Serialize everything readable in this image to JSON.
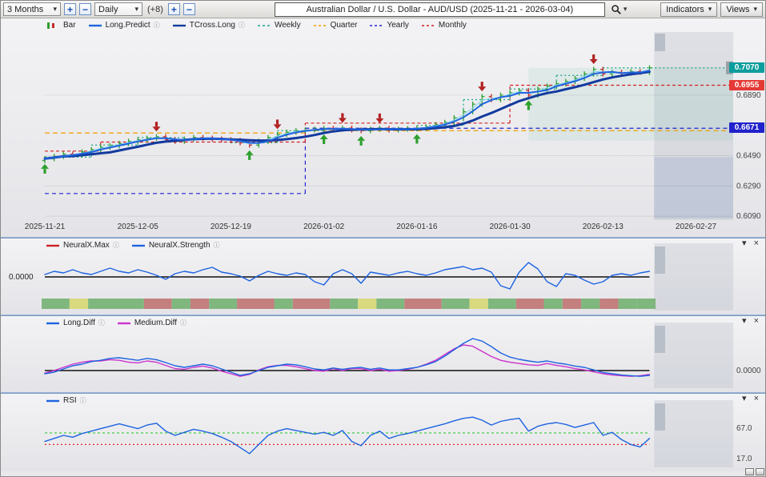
{
  "ui": {
    "caret": "▾",
    "close": "×",
    "collapse": "▾",
    "info": "ⓘ"
  },
  "colors": {
    "up": "#2e9e2e",
    "down": "#c22a2a",
    "long_predict": "#1e63e0",
    "tcross_long": "#123a9e",
    "pale_line": "#7fd4ef",
    "weekly": "#17a689",
    "quarter": "#f0a000",
    "yearly": "#2323cc",
    "monthly": "#d42020",
    "neural_max": "#cc2222",
    "neural_strength": "#1e63e0",
    "long_diff": "#1e63e0",
    "medium_diff": "#cc33cc",
    "rsi": "#1e63e0",
    "strip_green": "#7fb77f",
    "strip_red": "#c47f7f",
    "strip_yellow": "#d9d97f",
    "arrow_up": "#2ea02e",
    "arrow_down": "#b22222"
  },
  "toolbar": {
    "range_value": "3 Months",
    "zoom_in": "+",
    "zoom_out": "−",
    "period_value": "Daily",
    "extra_count": "(+8)",
    "add": "+",
    "remove": "−",
    "title": "Australian Dollar / U.S. Dollar - AUD/USD (2025-11-21 - 2026-03-04)",
    "indicators_label": "Indicators",
    "views_label": "Views"
  },
  "main_chart": {
    "legend": [
      {
        "label": "Bar",
        "style": "bar",
        "color": "#2e9e2e",
        "color2": "#c22a2a"
      },
      {
        "label": "Long.Predict",
        "style": "line",
        "color": "#1e63e0",
        "info": true
      },
      {
        "label": "TCross.Long",
        "style": "line",
        "color": "#123a9e",
        "info": true
      },
      {
        "label": "Weekly",
        "style": "dash",
        "color": "#17a689"
      },
      {
        "label": "Quarter",
        "style": "dash",
        "color": "#f0a000"
      },
      {
        "label": "Yearly",
        "style": "dash",
        "color": "#2323cc"
      },
      {
        "label": "Monthly",
        "style": "dash",
        "color": "#d42020"
      }
    ],
    "x_labels": [
      "2025-11-21",
      "2025-12-05",
      "2025-12-19",
      "2026-01-02",
      "2026-01-16",
      "2026-01-30",
      "2026-02-13",
      "2026-02-27"
    ],
    "x_label_indices": [
      0,
      10,
      20,
      30,
      40,
      50,
      60,
      70
    ],
    "y_tick_labels": [
      "0.6890",
      "0.6490",
      "0.6290",
      "0.6090"
    ],
    "y_tick_values": [
      0.689,
      0.649,
      0.629,
      0.609
    ],
    "badges": [
      {
        "text": "0.7070",
        "value": 0.707,
        "color": "#0d9d9d"
      },
      {
        "text": "0.6955",
        "value": 0.6955,
        "color": "#e53935"
      },
      {
        "text": "0.6671",
        "value": 0.6671,
        "color": "#2222cc"
      }
    ]
  },
  "panels": [
    {
      "id": "neural",
      "legend": [
        {
          "label": "NeuralX.Max",
          "style": "line",
          "color": "#cc2222",
          "info": true
        },
        {
          "label": "NeuralX.Strength",
          "style": "line",
          "color": "#1e63e0",
          "info": true
        }
      ]
    },
    {
      "id": "diff",
      "legend": [
        {
          "label": "Long.Diff",
          "style": "line",
          "color": "#1e63e0",
          "info": true
        },
        {
          "label": "Medium.Diff",
          "style": "line",
          "color": "#cc33cc",
          "info": true
        }
      ]
    },
    {
      "id": "rsi",
      "legend": [
        {
          "label": "RSI",
          "style": "line",
          "color": "#1e63e0",
          "info": true
        }
      ]
    }
  ],
  "chart_data": [
    {
      "id": "price",
      "type": "bar",
      "title": "Australian Dollar / U.S. Dollar - AUD/USD",
      "period": "Daily",
      "date_range": [
        "2025-11-21",
        "2026-03-04"
      ],
      "total_slots": 75,
      "forecast_start": 65,
      "y_range": [
        0.6075,
        0.7275
      ],
      "closes": [
        0.647,
        0.6485,
        0.65,
        0.6495,
        0.6515,
        0.653,
        0.6545,
        0.6555,
        0.657,
        0.6585,
        0.6595,
        0.6605,
        0.6615,
        0.6595,
        0.6585,
        0.66,
        0.661,
        0.6605,
        0.66,
        0.6595,
        0.659,
        0.6575,
        0.656,
        0.6585,
        0.661,
        0.663,
        0.6645,
        0.6655,
        0.666,
        0.6665,
        0.667,
        0.6665,
        0.6672,
        0.666,
        0.6655,
        0.6665,
        0.667,
        0.666,
        0.6665,
        0.6668,
        0.6672,
        0.668,
        0.6695,
        0.671,
        0.674,
        0.678,
        0.683,
        0.688,
        0.686,
        0.689,
        0.6905,
        0.692,
        0.689,
        0.693,
        0.695,
        0.6965,
        0.698,
        0.7,
        0.703,
        0.706,
        0.703,
        0.704,
        0.7035,
        0.7045,
        0.704,
        0.707
      ],
      "signals_up": [
        0,
        22,
        30,
        34,
        40,
        52
      ],
      "signals_down": [
        12,
        25,
        32,
        36,
        47,
        59
      ],
      "levels": {
        "weekly": [
          [
            0,
            5,
            0.648
          ],
          [
            5,
            10,
            0.656
          ],
          [
            10,
            15,
            0.661
          ],
          [
            15,
            20,
            0.66
          ],
          [
            20,
            25,
            0.6575
          ],
          [
            25,
            30,
            0.6655
          ],
          [
            30,
            35,
            0.6668
          ],
          [
            35,
            40,
            0.6663
          ],
          [
            40,
            45,
            0.669
          ],
          [
            45,
            50,
            0.686
          ],
          [
            50,
            55,
            0.693
          ],
          [
            55,
            60,
            0.702
          ],
          [
            60,
            74,
            0.707
          ]
        ],
        "monthly": [
          [
            0,
            6,
            0.652
          ],
          [
            6,
            28,
            0.658
          ],
          [
            28,
            50,
            0.6705
          ],
          [
            50,
            74,
            0.6955
          ]
        ],
        "yearly": [
          [
            0,
            28,
            0.624
          ],
          [
            28,
            74,
            0.6671
          ]
        ],
        "quarter": [
          [
            0,
            28,
            0.664
          ],
          [
            28,
            74,
            0.6655
          ]
        ]
      }
    },
    {
      "id": "neural",
      "type": "line",
      "y_range": [
        -1.2,
        1.2
      ],
      "zero_label": "0.0000",
      "series": [
        {
          "name": "NeuralX.Strength",
          "values": [
            0.15,
            0.35,
            0.25,
            0.45,
            0.25,
            0.15,
            0.35,
            0.55,
            0.35,
            0.25,
            0.45,
            0.3,
            0.1,
            -0.15,
            0.2,
            0.35,
            0.25,
            0.45,
            0.6,
            0.3,
            0.2,
            0.05,
            -0.25,
            0.1,
            0.35,
            0.2,
            0.1,
            0.25,
            0.15,
            -0.3,
            -0.5,
            0.2,
            0.45,
            0.2,
            -0.4,
            0.3,
            0.2,
            0.1,
            0.25,
            0.35,
            0.2,
            0.1,
            0.25,
            0.45,
            0.55,
            0.65,
            0.45,
            0.55,
            0.3,
            -0.55,
            -0.75,
            0.3,
            0.9,
            0.5,
            -0.3,
            -0.6,
            0.2,
            0.1,
            -0.2,
            -0.45,
            -0.3,
            0.1,
            0.2,
            0.1,
            0.25,
            0.35
          ]
        }
      ],
      "strip": [
        [
          "g",
          3
        ],
        [
          "y",
          2
        ],
        [
          "g",
          6
        ],
        [
          "r",
          3
        ],
        [
          "g",
          2
        ],
        [
          "r",
          2
        ],
        [
          "g",
          3
        ],
        [
          "r",
          4
        ],
        [
          "g",
          2
        ],
        [
          "r",
          4
        ],
        [
          "g",
          3
        ],
        [
          "y",
          2
        ],
        [
          "g",
          3
        ],
        [
          "r",
          4
        ],
        [
          "g",
          3
        ],
        [
          "y",
          2
        ],
        [
          "g",
          3
        ],
        [
          "r",
          3
        ],
        [
          "g",
          2
        ],
        [
          "r",
          2
        ],
        [
          "g",
          2
        ],
        [
          "r",
          2
        ],
        [
          "g",
          2
        ],
        [
          "g",
          2
        ]
      ]
    },
    {
      "id": "diff",
      "type": "line",
      "y_range": [
        -0.005,
        0.013
      ],
      "zero_label": "0.0000",
      "series": [
        {
          "name": "Long.Diff",
          "values": [
            -0.001,
            -0.0005,
            0.0005,
            0.0015,
            0.002,
            0.0028,
            0.0032,
            0.0038,
            0.004,
            0.0036,
            0.0032,
            0.0038,
            0.0034,
            0.0025,
            0.0015,
            0.001,
            0.0015,
            0.002,
            0.0015,
            0.0005,
            -0.0005,
            -0.0015,
            -0.001,
            0.0,
            0.001,
            0.0015,
            0.002,
            0.0018,
            0.0012,
            0.0005,
            0.0002,
            0.0008,
            0.0004,
            0.0008,
            0.001,
            0.0004,
            0.0008,
            0.0002,
            0.0002,
            0.0006,
            0.001,
            0.0018,
            0.0028,
            0.0045,
            0.0065,
            0.0085,
            0.01,
            0.0092,
            0.0075,
            0.0055,
            0.0042,
            0.0035,
            0.003,
            0.0026,
            0.003,
            0.0024,
            0.002,
            0.0014,
            0.001,
            0.0002,
            -0.0006,
            -0.001,
            -0.0014,
            -0.0016,
            -0.0018,
            -0.0015
          ]
        },
        {
          "name": "Medium.Diff",
          "values": [
            -0.0008,
            0.0,
            0.001,
            0.002,
            0.0026,
            0.003,
            0.003,
            0.0034,
            0.0032,
            0.0026,
            0.0024,
            0.003,
            0.0026,
            0.0016,
            0.0006,
            0.0004,
            0.001,
            0.0014,
            0.0008,
            -0.0002,
            -0.001,
            -0.0018,
            -0.0012,
            0.0002,
            0.0012,
            0.0016,
            0.0016,
            0.0012,
            0.0006,
            0.0,
            -0.0002,
            0.0006,
            0.0,
            0.0006,
            0.0006,
            0.0,
            0.0004,
            -0.0002,
            0.0,
            0.0004,
            0.001,
            0.002,
            0.0032,
            0.005,
            0.0068,
            0.008,
            0.0076,
            0.006,
            0.0044,
            0.0032,
            0.0026,
            0.0022,
            0.0018,
            0.0016,
            0.0022,
            0.0016,
            0.0012,
            0.0006,
            0.0002,
            -0.0004,
            -0.001,
            -0.0014,
            -0.0016,
            -0.0018,
            -0.0016,
            -0.0012
          ]
        }
      ]
    },
    {
      "id": "rsi",
      "type": "line",
      "y_range": [
        5,
        105
      ],
      "series": [
        {
          "name": "RSI",
          "values": [
            45,
            50,
            55,
            52,
            58,
            62,
            66,
            70,
            74,
            70,
            66,
            72,
            75,
            62,
            55,
            60,
            65,
            62,
            58,
            52,
            45,
            35,
            25,
            40,
            55,
            62,
            66,
            63,
            60,
            57,
            60,
            55,
            63,
            45,
            38,
            55,
            62,
            50,
            55,
            58,
            62,
            66,
            70,
            74,
            79,
            83,
            85,
            80,
            72,
            78,
            81,
            83,
            62,
            70,
            74,
            76,
            73,
            68,
            72,
            76,
            55,
            60,
            48,
            40,
            36,
            50
          ]
        }
      ],
      "levels": [
        {
          "value": 59,
          "color": "#33cc33",
          "dash": "3,3"
        },
        {
          "value": 40,
          "color": "#dd2222",
          "dash": "2,3"
        }
      ],
      "ticks": [
        {
          "label": "67.0",
          "value": 67
        },
        {
          "label": "17.0",
          "value": 17
        }
      ]
    }
  ]
}
